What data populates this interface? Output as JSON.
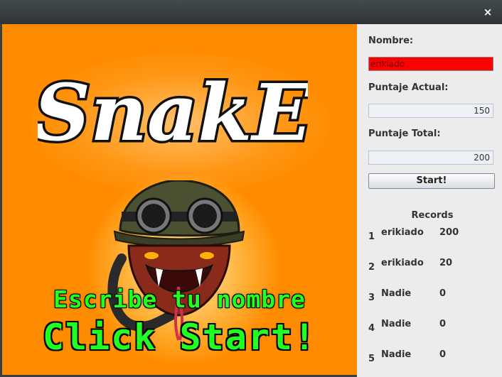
{
  "window": {
    "close_label": "×"
  },
  "canvas": {
    "logo_text": "SnakE",
    "line1": "Escribe tu nombre",
    "line2": "Click Start!",
    "background_color": "#ff8c00",
    "text_color": "#22ff22"
  },
  "form": {
    "name_label": "Nombre:",
    "name_value": "erikiado",
    "current_score_label": "Puntaje Actual:",
    "current_score_value": "150",
    "total_score_label": "Puntaje Total:",
    "total_score_value": "200",
    "start_label": "Start!"
  },
  "records": {
    "title": "Records",
    "rows": [
      {
        "rank": "1",
        "name": "erikiado",
        "score": "200"
      },
      {
        "rank": "2",
        "name": "erikiado",
        "score": "20"
      },
      {
        "rank": "3",
        "name": "Nadie",
        "score": "0"
      },
      {
        "rank": "4",
        "name": "Nadie",
        "score": "0"
      },
      {
        "rank": "5",
        "name": "Nadie",
        "score": "0"
      }
    ]
  }
}
